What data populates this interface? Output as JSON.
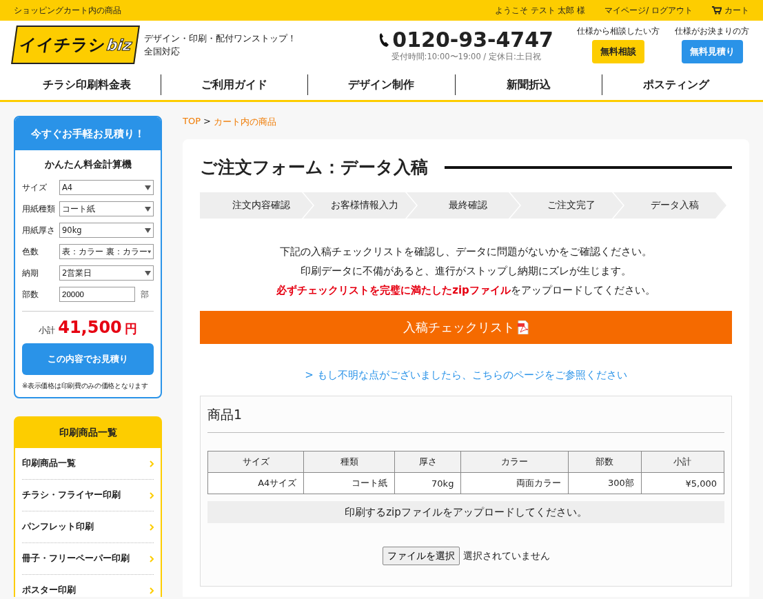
{
  "top_bar": {
    "title": "ショッピングカート内の商品",
    "welcome": "ようこそ テスト 太郎 様",
    "account_link": "マイページ/ ログアウト",
    "cart_link": "カート"
  },
  "header": {
    "logo": {
      "main": "イイチラシ",
      "suffix": "biz"
    },
    "tagline": [
      "デザイン・印刷・配付ワンストップ！",
      "全国対応"
    ],
    "phone": "0120-93-4747",
    "hours": "受付時間:10:00〜19:00 / 定休日:土日祝",
    "cta": [
      {
        "kind": "consult",
        "caption": "仕様から相談したい方",
        "label": "無料相談"
      },
      {
        "kind": "quote",
        "caption": "仕様がお決まりの方",
        "label": "無料見積り"
      }
    ]
  },
  "nav": [
    "チラシ印刷料金表",
    "ご利用ガイド",
    "デザイン制作",
    "新聞折込",
    "ポスティング"
  ],
  "calculator": {
    "banner": "今すぐお手軽お見積り！",
    "title": "かんたん料金計算機",
    "fields": [
      {
        "kind": "select",
        "label": "サイズ",
        "value": "A4"
      },
      {
        "kind": "select",
        "label": "用紙種類",
        "value": "コート紙"
      },
      {
        "kind": "select",
        "label": "用紙厚さ",
        "value": "90kg"
      },
      {
        "kind": "select",
        "label": "色数",
        "value": "表：カラー 裏：カラー"
      },
      {
        "kind": "select",
        "label": "納期",
        "value": "2営業日"
      },
      {
        "kind": "input",
        "label": "部数",
        "value": "20000",
        "unit": "部"
      }
    ],
    "subtotal_label": "小計",
    "subtotal": "41,500",
    "currency": "円",
    "button": "この内容でお見積り",
    "note": "※表示価格は印刷費のみの価格となります"
  },
  "products_menu": {
    "title": "印刷商品一覧",
    "items": [
      "印刷商品一覧",
      "チラシ・フライヤー印刷",
      "パンフレット印刷",
      "冊子・フリーペーパー印刷",
      "ポスター印刷"
    ]
  },
  "breadcrumb": {
    "separator": ">",
    "items": [
      {
        "label": "TOP"
      },
      {
        "label": "カート内の商品"
      }
    ]
  },
  "form": {
    "title": "ご注文フォーム：データ入稿",
    "steps": [
      "注文内容確認",
      "お客様情報入力",
      "最終確認",
      "ご注文完了",
      "データ入稿"
    ],
    "intro": [
      "下記の入稿チェックリストを確認し、データに問題がないかをご確認ください。",
      "印刷データに不備があると、進行がストップし納期にズレが生じます。"
    ],
    "warning": "必ずチェックリストを完璧に満たしたzipファイル",
    "warning_rest": "をアップロードしてください。",
    "checklist_button": "入稿チェックリスト",
    "help_link": "> もし不明な点がございましたら、こちらのページをご参照ください",
    "item": {
      "title": "商品1",
      "columns": [
        "サイズ",
        "種類",
        "厚さ",
        "カラー",
        "部数",
        "小計"
      ],
      "row": [
        "A4サイズ",
        "コート紙",
        "70kg",
        "両面カラー",
        "300部",
        "¥5,000"
      ],
      "upload_prompt": "印刷するzipファイルをアップロードしてください。",
      "file_button": "ファイルを選択",
      "file_status": "選択されていません"
    }
  }
}
